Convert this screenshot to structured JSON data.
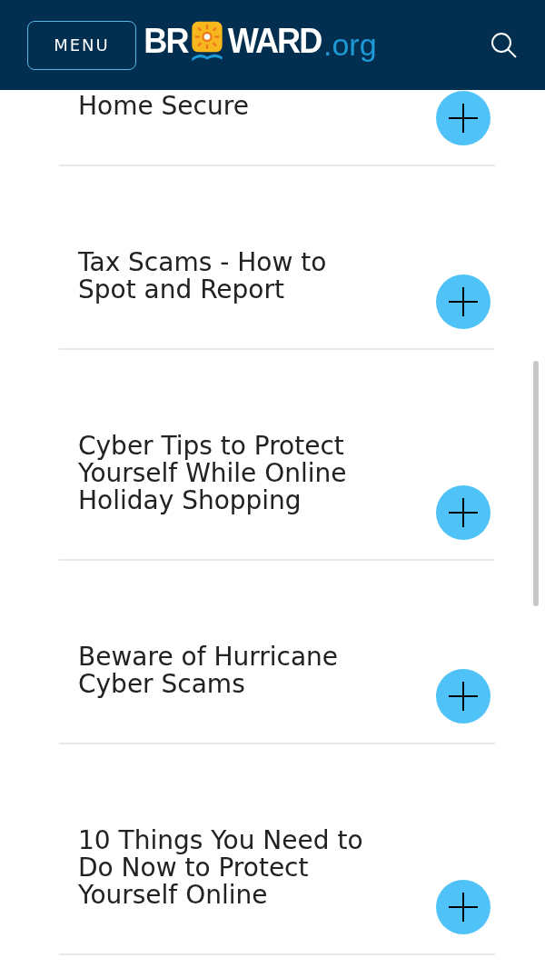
{
  "header": {
    "menu_button": "MENU",
    "logo": {
      "before": "BR",
      "after": "WARD",
      "suffix": ".org"
    }
  },
  "articles": [
    {
      "title": "Home Secure",
      "expanded": false
    },
    {
      "title": "Tax Scams - How to Spot and Report",
      "expanded": false
    },
    {
      "title": "Cyber Tips to Protect Yourself While Online Holiday Shopping",
      "expanded": false
    },
    {
      "title": "Beware of Hurricane Cyber Scams",
      "expanded": false
    },
    {
      "title": "10 Things You Need to Do Now to Protect Yourself Online",
      "expanded": false
    }
  ]
}
